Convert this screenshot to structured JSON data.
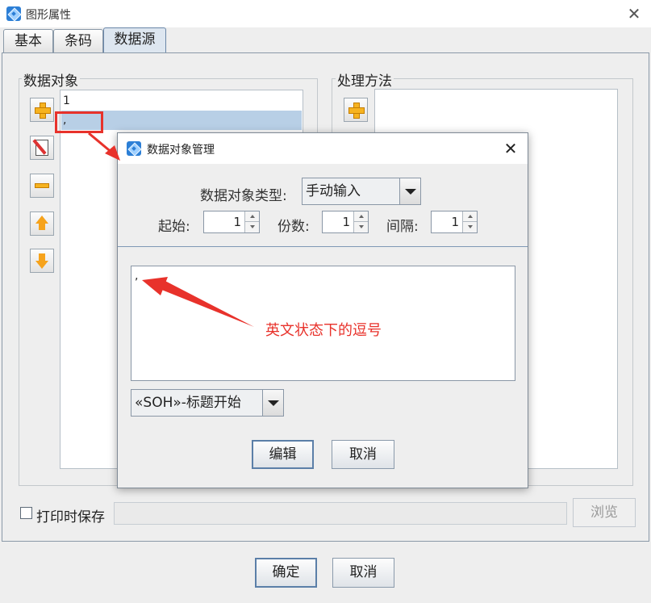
{
  "window": {
    "title": "图形属性",
    "close_glyph": "✕"
  },
  "tabs": [
    {
      "label": "基本"
    },
    {
      "label": "条码"
    },
    {
      "label": "数据源"
    }
  ],
  "data_object": {
    "group_title": "数据对象",
    "items": [
      "1",
      ","
    ]
  },
  "process": {
    "group_title": "处理方法"
  },
  "save": {
    "checkbox_label": "打印时保存",
    "path_value": "",
    "browse_label": "浏览"
  },
  "footer": {
    "ok_label": "确定",
    "cancel_label": "取消"
  },
  "dialog": {
    "title": "数据对象管理",
    "close_glyph": "✕",
    "type_label": "数据对象类型:",
    "type_value": "手动输入",
    "start_label": "起始:",
    "start_value": "1",
    "count_label": "份数:",
    "count_value": "1",
    "interval_label": "间隔:",
    "interval_value": "1",
    "text_value": ",",
    "special_char_value": "«SOH»-标题开始",
    "edit_label": "编辑",
    "cancel_label": "取消"
  },
  "annotation": {
    "text": "英文状态下的逗号",
    "color": "#e8322b"
  },
  "colors": {
    "selection": "#b8cfe6",
    "accent": "#5b7fa8",
    "annotation": "#e8322b"
  }
}
